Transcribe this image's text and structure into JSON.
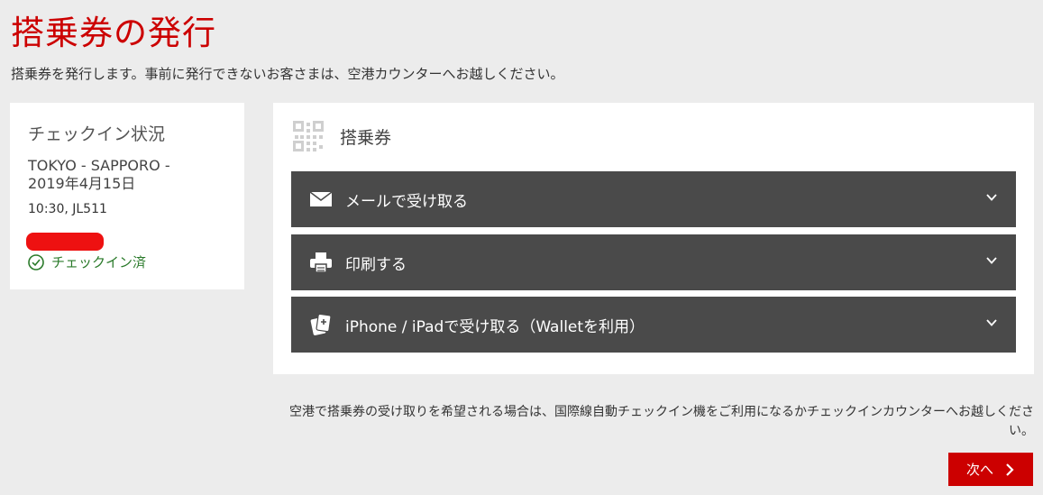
{
  "page": {
    "title": "搭乗券の発行",
    "subtitle": "搭乗券を発行します。事前に発行できないお客さまは、空港カウンターへお越しください。"
  },
  "status_card": {
    "title": "チェックイン状況",
    "route": "TOKYO - SAPPORO - 2019年4月15日",
    "flight": "10:30, JL511",
    "checked_in_label": "チェックイン済"
  },
  "boarding_pass": {
    "title": "搭乗券",
    "options": [
      {
        "label": "メールで受け取る",
        "icon": "mail-icon"
      },
      {
        "label": "印刷する",
        "icon": "printer-icon"
      },
      {
        "label": "iPhone / iPadで受け取る（Walletを利用）",
        "icon": "wallet-icon"
      }
    ]
  },
  "note": "空港で搭乗券の受け取りを希望される場合は、国際線自動チェックイン機をご利用になるかチェックインカウンターへお越しください。",
  "next_button": {
    "label": "次へ"
  },
  "colors": {
    "accent": "#cc0000",
    "option_bg": "#4a4a4a",
    "success": "#2a7a2a",
    "background": "#ececec"
  }
}
